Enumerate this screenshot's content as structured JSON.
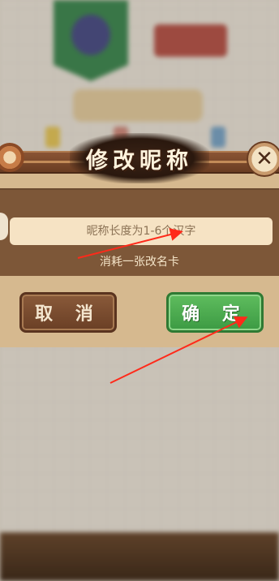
{
  "dialog": {
    "title": "修改昵称",
    "close_icon": "close-icon",
    "input": {
      "placeholder": "昵称长度为1-6个汉字",
      "value": ""
    },
    "hint": "消耗一张改名卡",
    "cancel_label": "取 消",
    "confirm_label": "确 定"
  },
  "colors": {
    "panel": "#7d5738",
    "confirm_green": "#4aa94c",
    "cancel_brown": "#7a4d30",
    "annotation_red": "#ff2a1a"
  }
}
